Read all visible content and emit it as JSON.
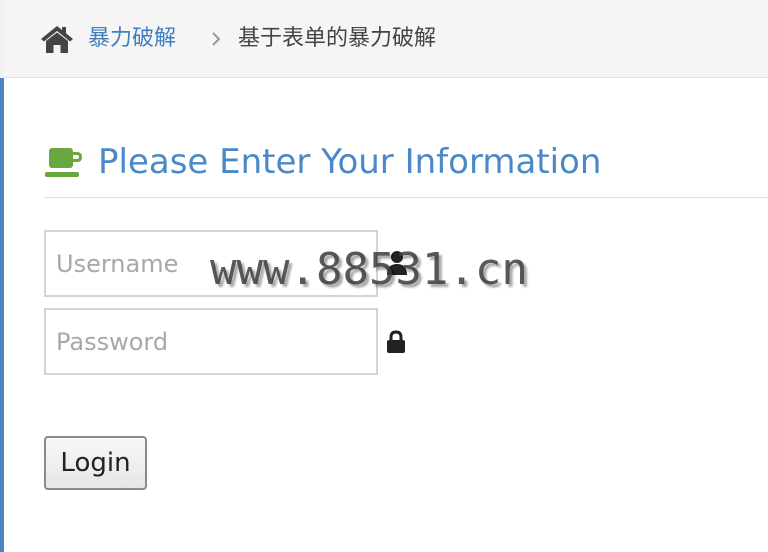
{
  "breadcrumb": {
    "home_icon": "home-icon",
    "link_label": "暴力破解",
    "separator_icon": "chevron-right-icon",
    "current_label": "基于表单的暴力破解"
  },
  "main": {
    "heading_icon": "coffee-icon",
    "heading": "Please Enter Your Information",
    "accent_color": "#4a89c7"
  },
  "form": {
    "username_placeholder": "Username",
    "username_value": "",
    "username_icon": "user-icon",
    "password_placeholder": "Password",
    "password_value": "",
    "password_icon": "lock-icon",
    "login_label": "Login"
  },
  "watermark": {
    "text": "www.88531.cn"
  }
}
